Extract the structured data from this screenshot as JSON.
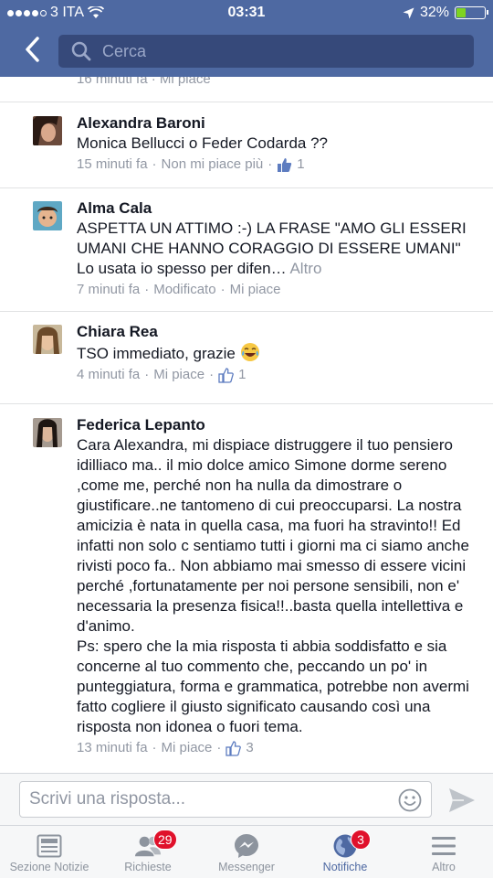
{
  "status_bar": {
    "carrier": "3 ITA",
    "time": "03:31",
    "battery": "32%",
    "battery_level": 0.32
  },
  "header": {
    "search_placeholder": "Cerca"
  },
  "partial_top": {
    "meta": "16 minuti fa · Mi piace"
  },
  "comments": [
    {
      "author": "Alexandra Baroni",
      "text": "Monica Bellucci  o Feder Codarda ??",
      "time": "15 minuti fa",
      "action": "Non mi piace più",
      "likes": "1"
    },
    {
      "author": "Alma Cala",
      "text": "ASPETTA UN ATTIMO :-) LA FRASE \"AMO GLI ESSERI  UMANI CHE HANNO CORAGGIO DI ESSERE UMANI\" Lo usata io spesso per difen…",
      "more": "Altro",
      "time": "7 minuti fa",
      "edited": "Modificato",
      "action": "Mi piace"
    },
    {
      "author": "Chiara Rea",
      "text": "TSO immediato, grazie",
      "time": "4 minuti fa",
      "action": "Mi piace",
      "likes": "1"
    },
    {
      "author": "Federica Lepanto",
      "text": "Cara Alexandra, mi dispiace distruggere il tuo pensiero idilliaco ma.. il mio dolce amico Simone dorme sereno ,come me, perché non ha nulla da dimostrare o giustificare..ne tantomeno di cui preoccuparsi. La nostra amicizia è nata in quella casa, ma fuori ha stravinto!! Ed infatti non solo c sentiamo tutti i giorni ma ci siamo anche rivisti poco fa.. Non abbiamo mai smesso di essere vicini perché ,fortunatamente per noi persone sensibili, non e' necessaria la presenza fisica!!..basta quella intellettiva e d'animo.\nPs: spero che la mia risposta ti abbia soddisfatto e sia concerne al tuo commento che, peccando un po' in punteggiatura, forma e grammatica, potrebbe non avermi fatto cogliere il giusto significato causando così una risposta non idonea o fuori tema.",
      "time": "13 minuti fa",
      "action": "Mi piace",
      "likes": "3"
    }
  ],
  "reply": {
    "placeholder": "Scrivi una risposta..."
  },
  "tabs": [
    {
      "label": "Sezione Notizie",
      "badge": ""
    },
    {
      "label": "Richieste",
      "badge": "29"
    },
    {
      "label": "Messenger",
      "badge": ""
    },
    {
      "label": "Notifiche",
      "badge": "3"
    },
    {
      "label": "Altro",
      "badge": ""
    }
  ],
  "colors": {
    "header": "#4e69a2",
    "search": "#36497a",
    "badge": "#e0112b",
    "active_tab": "#4e69a2",
    "meta": "#9197a3"
  }
}
